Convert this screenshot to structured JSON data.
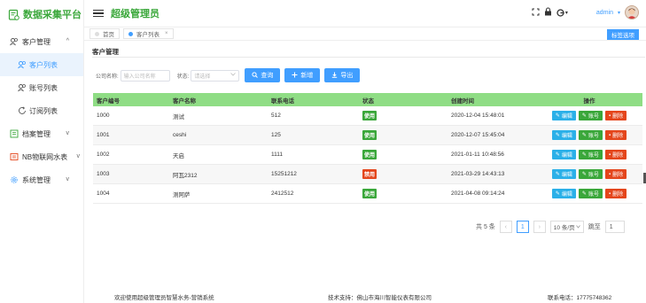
{
  "app": {
    "logo_text": "数据采集平台",
    "site_title": "超级管理员"
  },
  "sidebar": {
    "items": [
      {
        "label": "客户管理",
        "caret": "^"
      },
      {
        "label": "客户列表"
      },
      {
        "label": "账号列表"
      },
      {
        "label": "订阅列表"
      },
      {
        "label": "档案管理",
        "caret": "v"
      },
      {
        "label": "NB物联网水表",
        "caret": "v"
      },
      {
        "label": "系统管理",
        "caret": "v"
      }
    ]
  },
  "header": {
    "admin_name": "admin",
    "admin_caret": "▾",
    "theme_caret": "▾"
  },
  "tabs": [
    {
      "label": "首页",
      "dot_color": "#c9c9c9"
    },
    {
      "label": "客户列表",
      "dot_color": "#409eff",
      "close": "×"
    }
  ],
  "tab_options_label": "标签选项",
  "page": {
    "heading": "客户管理"
  },
  "filter": {
    "name_label": "公司名称:",
    "name_placeholder": "输入公司名称",
    "status_label": "状态:",
    "status_placeholder": "请选择",
    "query_label": "查询",
    "add_label": "新增",
    "export_label": "导出"
  },
  "table": {
    "headers": [
      "客户编号",
      "客户名称",
      "联系电话",
      "状态",
      "创建时间",
      "操作"
    ],
    "rows": [
      {
        "id": "1000",
        "name": "测试",
        "phone": "512",
        "status": "使用",
        "created": "2020-12-04 15:48:01"
      },
      {
        "id": "1001",
        "name": "ceshi",
        "phone": "125",
        "status": "使用",
        "created": "2020-12-07 15:45:04"
      },
      {
        "id": "1002",
        "name": "天启",
        "phone": "1111",
        "status": "使用",
        "created": "2021-01-11 10:48:56"
      },
      {
        "id": "1003",
        "name": "阿瓦2312",
        "phone": "15251212",
        "status": "禁用",
        "created": "2021-03-29 14:43:13"
      },
      {
        "id": "1004",
        "name": "测阿萨",
        "phone": "2412512",
        "status": "使用",
        "created": "2021-04-08 09:14:24"
      }
    ],
    "actions": {
      "edit": "编辑",
      "account": "账号",
      "delete": "删除"
    }
  },
  "pagination": {
    "total": "共 5 条",
    "prev": "‹",
    "current_page": "1",
    "next": "›",
    "page_size": "10 条/页",
    "jump_label": "跳至",
    "jump_value": "1"
  },
  "footer": {
    "left": "欢迎使用超级管理员智慧水务-营销系统",
    "middle": "技术支持：佛山市海川智能仪表有限公司",
    "right": "联系电话：17775748362"
  },
  "colors": {
    "brand_green": "#3aa73a",
    "primary_blue": "#409eff",
    "danger": "#e4461c",
    "info": "#2bb0e8",
    "header_green": "#8fdd85"
  }
}
